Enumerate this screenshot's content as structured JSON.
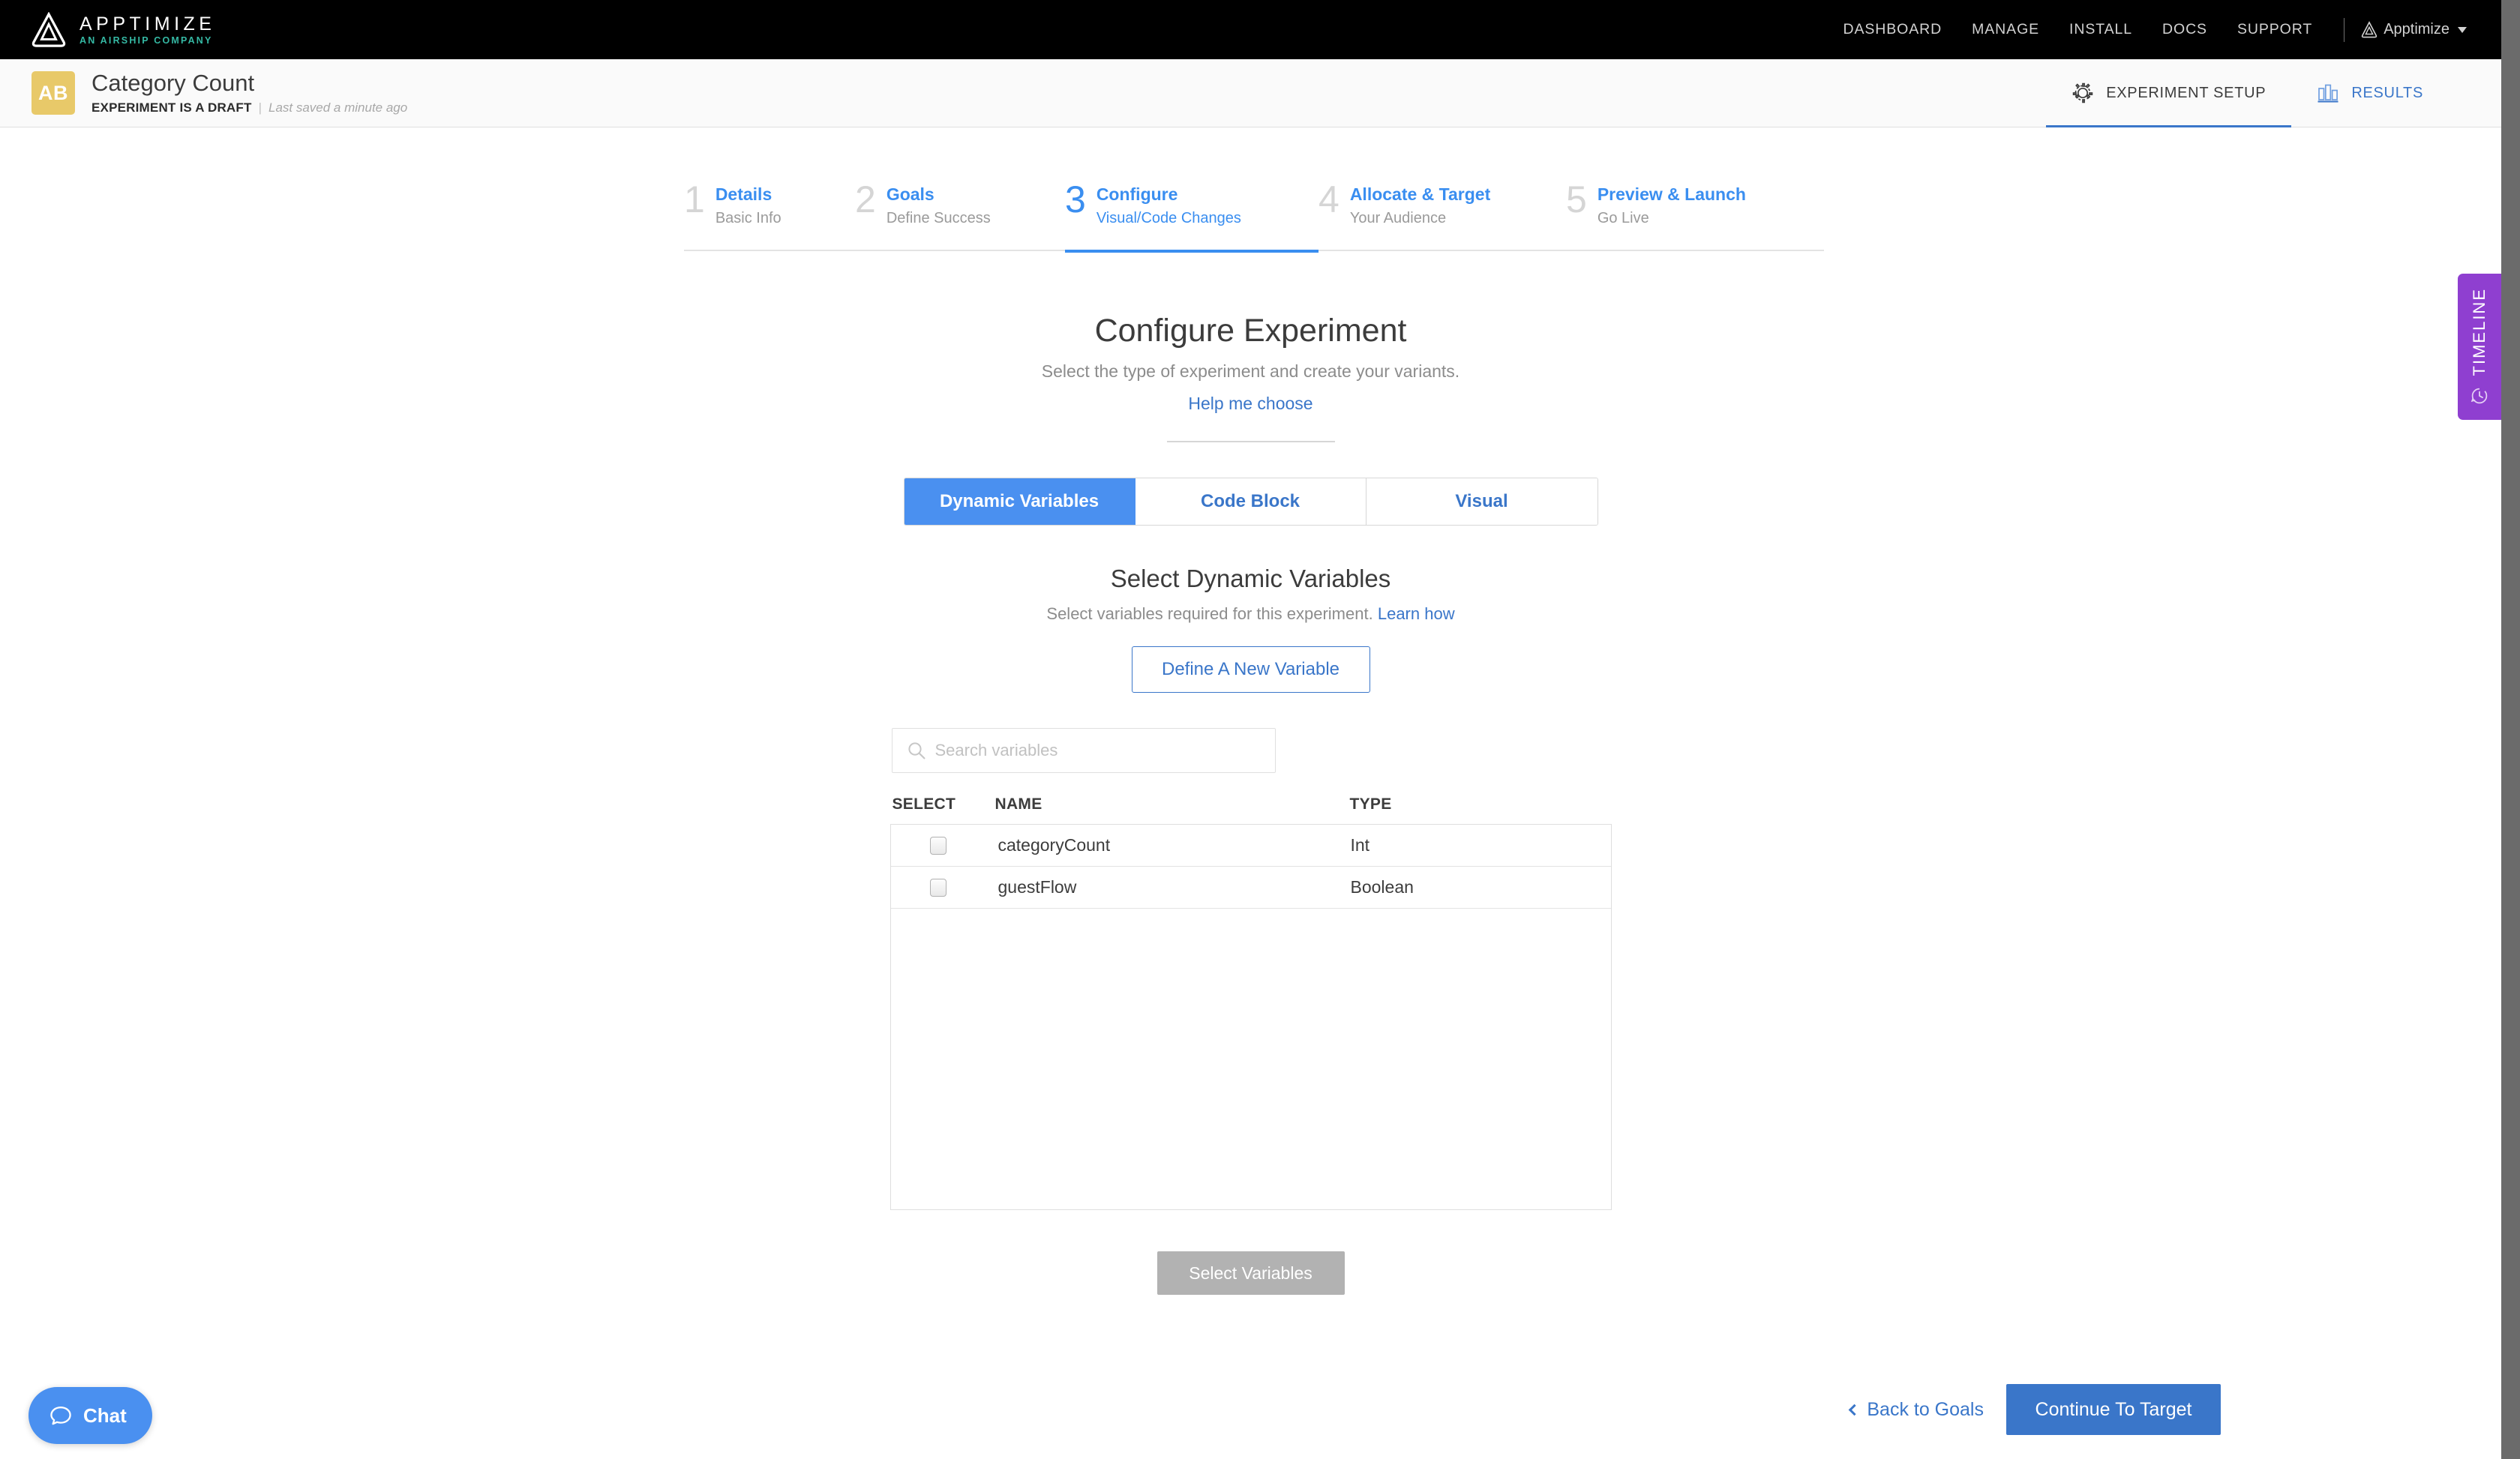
{
  "topnav": {
    "brand_name": "APPTIMIZE",
    "brand_sub": "AN AIRSHIP COMPANY",
    "links": [
      {
        "label": "DASHBOARD"
      },
      {
        "label": "MANAGE"
      },
      {
        "label": "INSTALL"
      },
      {
        "label": "DOCS"
      },
      {
        "label": "SUPPORT"
      }
    ],
    "account_label": "Apptimize",
    "bg_color": "#000000",
    "accent_color": "#35b9a4"
  },
  "subheader": {
    "badge": "AB",
    "badge_color": "#e8c969",
    "title": "Category Count",
    "status": "EXPERIMENT IS A DRAFT",
    "separator": "|",
    "saved": "Last saved a minute ago",
    "tabs": [
      {
        "label": "EXPERIMENT SETUP",
        "icon": "gear-icon",
        "active": true
      },
      {
        "label": "RESULTS",
        "icon": "bar-chart-icon",
        "active": false
      }
    ]
  },
  "wizard": {
    "steps": [
      {
        "num": "1",
        "title": "Details",
        "sub": "Basic Info",
        "state": "done"
      },
      {
        "num": "2",
        "title": "Goals",
        "sub": "Define Success",
        "state": "done"
      },
      {
        "num": "3",
        "title": "Configure",
        "sub": "Visual/Code Changes",
        "state": "current"
      },
      {
        "num": "4",
        "title": "Allocate & Target",
        "sub": "Your Audience",
        "state": "todo"
      },
      {
        "num": "5",
        "title": "Preview & Launch",
        "sub": "Go Live",
        "state": "todo"
      }
    ],
    "active_color": "#3a8ef0",
    "inactive_color": "#d5d5d5"
  },
  "main": {
    "page_title": "Configure Experiment",
    "page_sub": "Select the type of experiment and create your variants.",
    "help_link": "Help me choose",
    "tabs": [
      {
        "label": "Dynamic Variables",
        "selected": true
      },
      {
        "label": "Code Block",
        "selected": false
      },
      {
        "label": "Visual",
        "selected": false
      }
    ],
    "section_title": "Select Dynamic Variables",
    "section_sub": "Select variables required for this experiment.",
    "section_sub_link": "Learn how",
    "define_button": "Define A New Variable",
    "search_placeholder": "Search variables",
    "search_value": "",
    "table": {
      "columns": [
        "SELECT",
        "NAME",
        "TYPE"
      ],
      "rows": [
        {
          "select": false,
          "name": "categoryCount",
          "type": "Int"
        },
        {
          "select": false,
          "name": "guestFlow",
          "type": "Boolean"
        }
      ]
    },
    "select_variables_button": "Select Variables",
    "select_variables_disabled": true
  },
  "footer": {
    "back_label": "Back to Goals",
    "continue_label": "Continue To Target",
    "continue_color": "#3a76c9"
  },
  "chat": {
    "label": "Chat",
    "color": "#4a90f0"
  },
  "timeline": {
    "label": "TIMELINE",
    "color": "#8f3fd0"
  }
}
